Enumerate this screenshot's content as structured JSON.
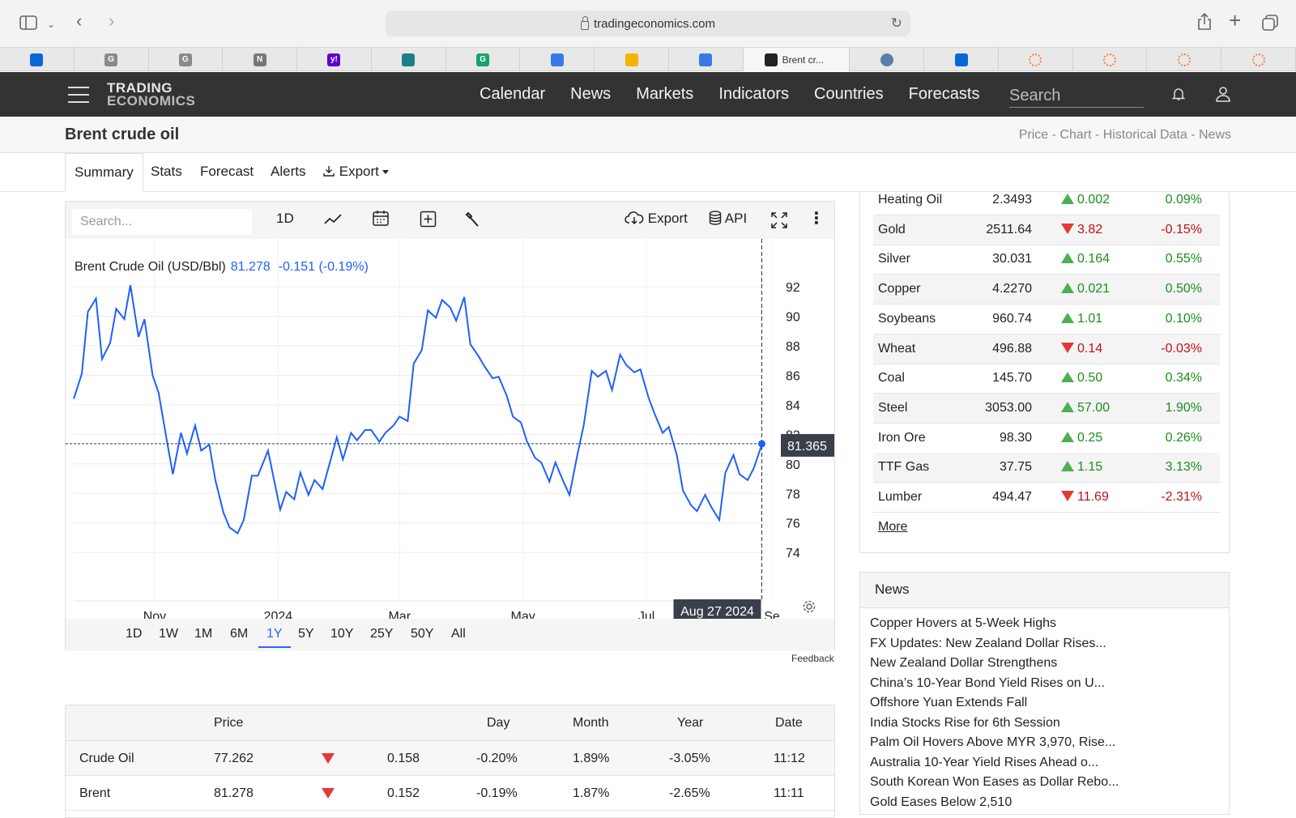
{
  "browser": {
    "url": "tradingeconomics.com",
    "active_tab_title": "Brent cr...",
    "tab_favicons": [
      "trello-icon",
      "google-icon",
      "google-icon",
      "notion-icon",
      "yahoo-icon",
      "chart-icon",
      "grammarly-icon",
      "docs-icon",
      "drive-icon",
      "docs-icon",
      "tradingeconomics-icon",
      "globe-icon",
      "trello-icon",
      "spinner-icon",
      "spinner-icon",
      "spinner-icon",
      "spinner-icon"
    ]
  },
  "site": {
    "logo_line1": "TRADING",
    "logo_line2": "ECONOMICS",
    "nav": [
      "Calendar",
      "News",
      "Markets",
      "Indicators",
      "Countries",
      "Forecasts"
    ],
    "search_placeholder": "Search"
  },
  "page": {
    "title": "Brent crude oil",
    "breadcrumbs": "Price - Chart - Historical Data - News",
    "subtabs": [
      "Summary",
      "Stats",
      "Forecast",
      "Alerts",
      "Export"
    ]
  },
  "chart_toolbar": {
    "search_placeholder": "Search...",
    "interval": "1D",
    "export_label": "Export",
    "api_label": "API"
  },
  "chart_data": {
    "type": "line",
    "title": "Brent Crude Oil (USD/Bbl)",
    "last_value": "81.278",
    "change": "-0.151 (-0.19%)",
    "current_marker": "81.365",
    "crosshair_date": "Aug 27 2024",
    "x_tick_labels": [
      "Nov",
      "2024",
      "Mar",
      "May",
      "Jul",
      "Se"
    ],
    "y_ticks": [
      74,
      76,
      78,
      80,
      82,
      84,
      86,
      88,
      90,
      92
    ],
    "ylim": [
      72.2,
      93.7
    ],
    "x_range": [
      "2023-09-22",
      "2024-08-28"
    ],
    "grid": true,
    "x": [
      "2023-09-22",
      "2023-09-26",
      "2023-09-29",
      "2023-10-03",
      "2023-10-06",
      "2023-10-10",
      "2023-10-13",
      "2023-10-17",
      "2023-10-20",
      "2023-10-24",
      "2023-10-27",
      "2023-10-31",
      "2023-11-03",
      "2023-11-07",
      "2023-11-10",
      "2023-11-14",
      "2023-11-17",
      "2023-11-21",
      "2023-11-24",
      "2023-11-28",
      "2023-12-01",
      "2023-12-05",
      "2023-12-08",
      "2023-12-12",
      "2023-12-15",
      "2023-12-19",
      "2023-12-22",
      "2023-12-27",
      "2024-01-02",
      "2024-01-05",
      "2024-01-09",
      "2024-01-12",
      "2024-01-16",
      "2024-01-19",
      "2024-01-23",
      "2024-01-26",
      "2024-01-30",
      "2024-02-02",
      "2024-02-06",
      "2024-02-09",
      "2024-02-13",
      "2024-02-16",
      "2024-02-20",
      "2024-02-23",
      "2024-02-27",
      "2024-03-01",
      "2024-03-05",
      "2024-03-08",
      "2024-03-12",
      "2024-03-15",
      "2024-03-19",
      "2024-03-22",
      "2024-03-26",
      "2024-03-29",
      "2024-04-02",
      "2024-04-05",
      "2024-04-09",
      "2024-04-12",
      "2024-04-16",
      "2024-04-19",
      "2024-04-23",
      "2024-04-26",
      "2024-04-30",
      "2024-05-03",
      "2024-05-07",
      "2024-05-10",
      "2024-05-14",
      "2024-05-17",
      "2024-05-21",
      "2024-05-24",
      "2024-05-28",
      "2024-05-31",
      "2024-06-04",
      "2024-06-07",
      "2024-06-11",
      "2024-06-14",
      "2024-06-18",
      "2024-06-21",
      "2024-06-25",
      "2024-06-28",
      "2024-07-02",
      "2024-07-05",
      "2024-07-09",
      "2024-07-12",
      "2024-07-16",
      "2024-07-19",
      "2024-07-23",
      "2024-07-26",
      "2024-07-30",
      "2024-08-02",
      "2024-08-06",
      "2024-08-09",
      "2024-08-13",
      "2024-08-16",
      "2024-08-20",
      "2024-08-23",
      "2024-08-27"
    ],
    "series": [
      {
        "values": [
          84.4,
          86.1,
          90.3,
          91.2,
          87.1,
          88.2,
          90.5,
          89.8,
          92.1,
          88.6,
          89.8,
          86.0,
          84.8,
          81.6,
          79.3,
          82.1,
          80.7,
          82.6,
          80.9,
          81.3,
          78.9,
          76.7,
          75.7,
          75.3,
          76.2,
          79.2,
          79.2,
          80.9,
          76.9,
          78.1,
          77.6,
          79.4,
          77.9,
          78.9,
          78.3,
          79.8,
          81.8,
          80.3,
          82.1,
          81.6,
          82.3,
          82.3,
          81.5,
          82.1,
          82.6,
          83.2,
          82.9,
          86.8,
          87.7,
          90.4,
          89.9,
          91.1,
          90.6,
          89.7,
          91.3,
          88.1,
          87.3,
          86.6,
          85.8,
          85.9,
          84.6,
          83.2,
          82.8,
          81.5,
          80.4,
          80.1,
          78.8,
          80.1,
          78.8,
          77.9,
          80.7,
          82.6,
          86.3,
          85.9,
          86.3,
          85.0,
          87.4,
          86.7,
          86.2,
          86.4,
          84.5,
          83.4,
          82.1,
          82.5,
          80.6,
          78.2,
          77.2,
          76.8,
          77.9,
          77.1,
          76.2,
          79.4,
          80.6,
          79.3,
          78.9,
          79.7,
          81.3
        ]
      }
    ]
  },
  "range_buttons": [
    "1D",
    "1W",
    "1M",
    "6M",
    "1Y",
    "5Y",
    "10Y",
    "25Y",
    "50Y",
    "All"
  ],
  "active_range": "1Y",
  "feedback": "Feedback",
  "commodities": [
    {
      "name": "Heating Oil",
      "price": "2.3493",
      "dir": "up",
      "change": "0.002",
      "pct": "0.09%"
    },
    {
      "name": "Gold",
      "price": "2511.64",
      "dir": "down",
      "change": "3.82",
      "pct": "-0.15%"
    },
    {
      "name": "Silver",
      "price": "30.031",
      "dir": "up",
      "change": "0.164",
      "pct": "0.55%"
    },
    {
      "name": "Copper",
      "price": "4.2270",
      "dir": "up",
      "change": "0.021",
      "pct": "0.50%"
    },
    {
      "name": "Soybeans",
      "price": "960.74",
      "dir": "up",
      "change": "1.01",
      "pct": "0.10%"
    },
    {
      "name": "Wheat",
      "price": "496.88",
      "dir": "down",
      "change": "0.14",
      "pct": "-0.03%"
    },
    {
      "name": "Coal",
      "price": "145.70",
      "dir": "up",
      "change": "0.50",
      "pct": "0.34%"
    },
    {
      "name": "Steel",
      "price": "3053.00",
      "dir": "up",
      "change": "57.00",
      "pct": "1.90%"
    },
    {
      "name": "Iron Ore",
      "price": "98.30",
      "dir": "up",
      "change": "0.25",
      "pct": "0.26%"
    },
    {
      "name": "TTF Gas",
      "price": "37.75",
      "dir": "up",
      "change": "1.15",
      "pct": "3.13%"
    },
    {
      "name": "Lumber",
      "price": "494.47",
      "dir": "down",
      "change": "11.69",
      "pct": "-2.31%"
    }
  ],
  "more_label": "More",
  "news": {
    "heading": "News",
    "items": [
      "Copper Hovers at 5-Week Highs",
      "FX Updates: New Zealand Dollar Rises...",
      "New Zealand Dollar Strengthens",
      "China’s 10-Year Bond Yield Rises on U...",
      "Offshore Yuan Extends Fall",
      "India Stocks Rise for 6th Session",
      "Palm Oil Hovers Above MYR 3,970, Rise...",
      "Australia 10-Year Yield Rises Ahead o...",
      "South Korean Won Eases as Dollar Rebo...",
      "Gold Eases Below 2,510"
    ]
  },
  "price_table": {
    "headers": [
      "Price",
      "Day",
      "Month",
      "Year",
      "Date"
    ],
    "rows": [
      {
        "name": "Crude Oil",
        "price": "77.262",
        "change": "0.158",
        "day": "-0.20%",
        "month": "1.89%",
        "year": "-3.05%",
        "date": "11:12"
      },
      {
        "name": "Brent",
        "price": "81.278",
        "change": "0.152",
        "day": "-0.19%",
        "month": "1.87%",
        "year": "-2.65%",
        "date": "11:11"
      }
    ]
  },
  "colors": {
    "line": "#1f5fff",
    "nav_bg": "#333333",
    "up": "#4caf50",
    "down": "#e53935"
  }
}
